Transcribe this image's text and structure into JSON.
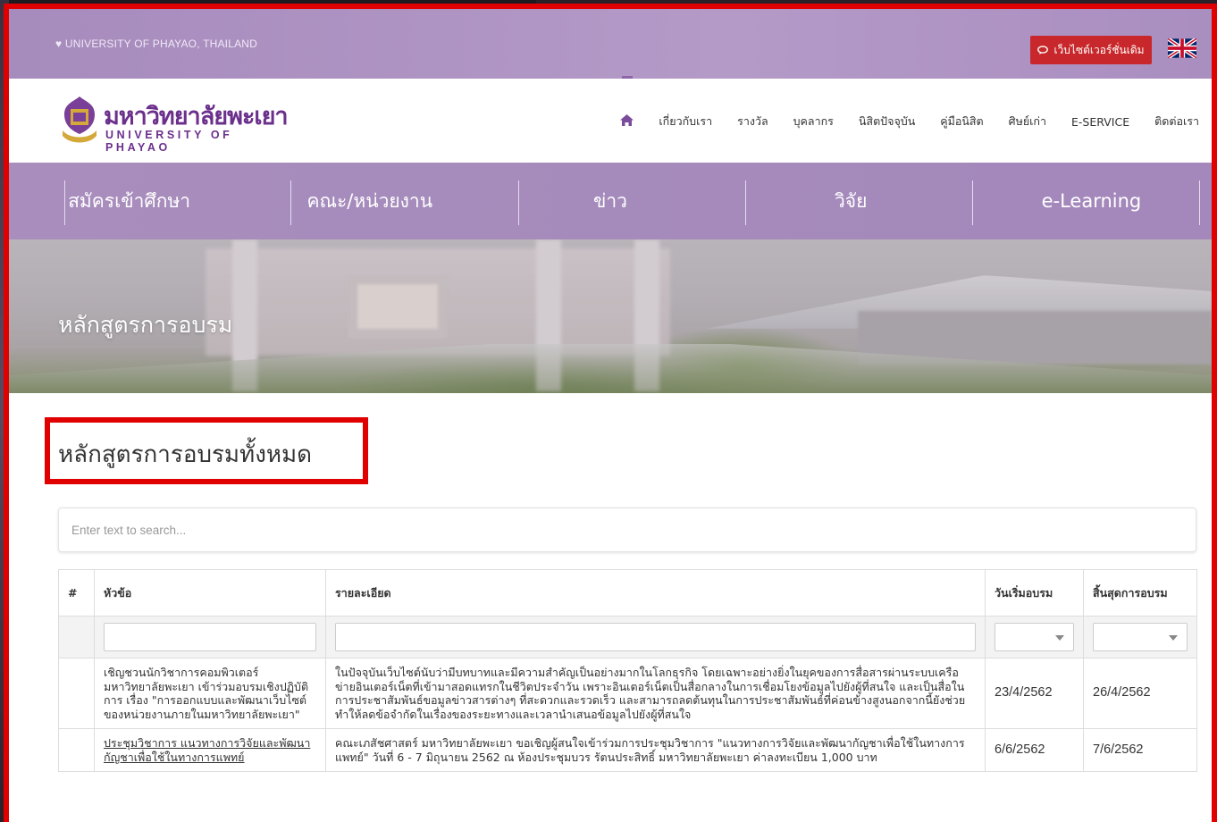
{
  "topbar": {
    "location": "♥ UNIVERSITY OF PHAYAO, THAILAND",
    "old_site_label": "เว็บไซต์เวอร์ชั่นเดิม"
  },
  "logo": {
    "thai_name": "มหาวิทยาลัยพะเยา",
    "english_name": "UNIVERSITY OF PHAYAO"
  },
  "nav": {
    "items": [
      "เกี่ยวกับเรา",
      "รางวัล",
      "บุคลากร",
      "นิสิตปัจจุบัน",
      "คู่มือนิสิต",
      "ศิษย์เก่า",
      "E-SERVICE",
      "ติดต่อเรา"
    ]
  },
  "menubar": {
    "items": [
      "สมัครเข้าศึกษา",
      "คณะ/หน่วยงาน",
      "ข่าว",
      "วิจัย",
      "e-Learning"
    ]
  },
  "hero": {
    "title": "หลักสูตรการอบรม"
  },
  "section": {
    "title": "หลักสูตรการอบรมทั้งหมด"
  },
  "search": {
    "placeholder": "Enter text to search..."
  },
  "table": {
    "headers": [
      "#",
      "หัวข้อ",
      "รายละเอียด",
      "วันเริ่มอบรม",
      "สิ้นสุดการอบรม"
    ],
    "rows": [
      {
        "num": "",
        "topic": "เชิญชวนนักวิชาการคอมพิวเตอร์ มหาวิทยาลัยพะเยา เข้าร่วมอบรมเชิงปฏิบัติการ เรื่อง \"การออกแบบและพัฒนาเว็บไซต์ของหน่วยงานภายในมหาวิทยาลัยพะเยา\"",
        "detail": "ในปัจจุบันเว็บไซต์นับว่ามีบทบาทและมีความสำคัญเป็นอย่างมากในโลกธุรกิจ โดยเฉพาะอย่างยิ่งในยุคของการสื่อสารผ่านระบบเครือข่ายอินเตอร์เน็ตที่เข้ามาสอดแทรกในชีวิตประจำวัน เพราะอินเตอร์เน็ตเป็นสื่อกลางในการเชื่อมโยงข้อมูลไปยังผู้ที่สนใจ และเป็นสื่อในการประชาสัมพันธ์ขอมูลข่าวสารต่างๆ ที่สะดวกและรวดเร็ว และสามารถลดต้นทุนในการประชาสัมพันธ์ที่ค่อนข้างสูงนอกจากนี้ยังช่วยทำให้ลดข้อจำกัดในเรื่องของระยะทางและเวลานำเสนอข้อมูลไปยังผู้ที่สนใจ",
        "start": "23/4/2562",
        "end": "26/4/2562"
      },
      {
        "num": "",
        "topic": "ประชุมวิชาการ แนวทางการวิจัยและพัฒนากัญชาเพื่อใช้ในทางการแพทย์",
        "detail": "คณะเภสัชศาสตร์ มหาวิทยาลัยพะเยา ขอเชิญผู้สนใจเข้าร่วมการประชุมวิชาการ \"แนวทางการวิจัยและพัฒนากัญชาเพื่อใช้ในทางการแพทย์\" วันที่ 6 - 7 มิถุนายน 2562 ณ ห้องประชุมบวร รัตนประสิทธิ์ มหาวิทยาลัยพะเยา ค่าลงทะเบียน 1,000 บาท",
        "start": "6/6/2562",
        "end": "7/6/2562"
      }
    ]
  },
  "colors": {
    "brand_purple": "#6b2f8c",
    "menu_purple": "#a88dbd",
    "alert_red": "#c8282b"
  }
}
